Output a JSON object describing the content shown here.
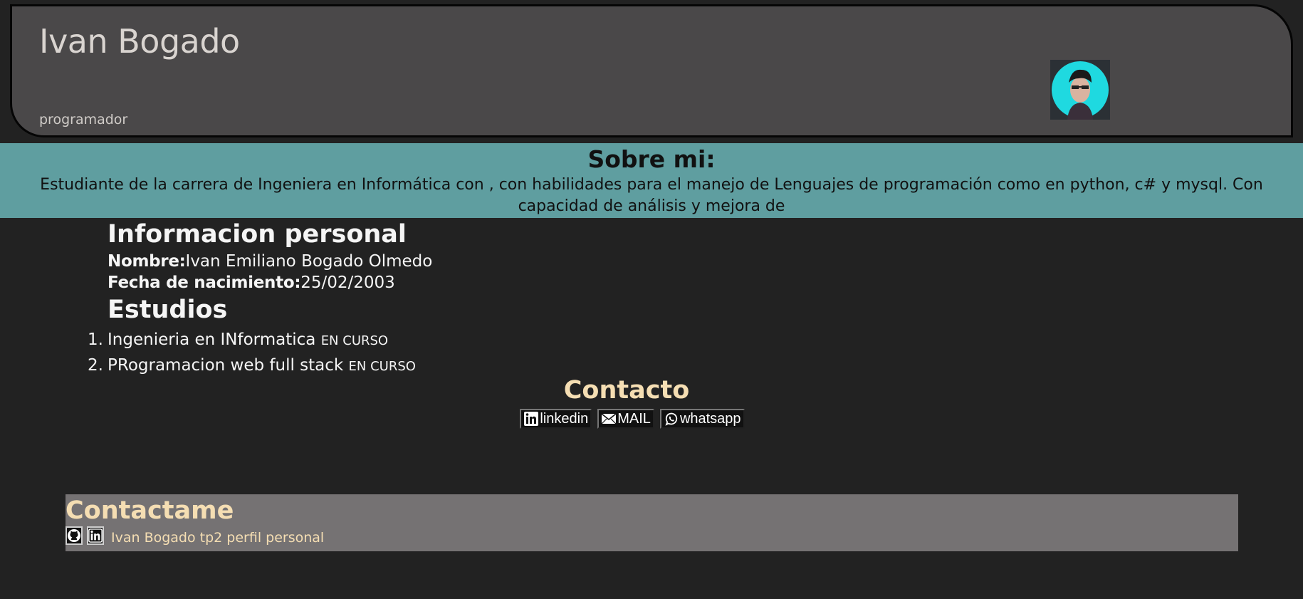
{
  "header": {
    "name": "Ivan Bogado",
    "role": "programador"
  },
  "about": {
    "title": "Sobre mi:",
    "text": "Estudiante de la carrera de Ingeniera en Informática con , con habilidades para el manejo de Lenguajes de programación como en python, c# y mysql. Con capacidad de análisis y mejora de"
  },
  "personal": {
    "heading": "Informacion personal",
    "name_label": "Nombre:",
    "name_value": "Ivan Emiliano Bogado Olmedo",
    "birth_label": "Fecha de nacimiento:",
    "birth_value": "25/02/2003"
  },
  "studies": {
    "heading": "Estudios",
    "items": [
      {
        "num": "1.",
        "title": "Ingenieria en INformatica",
        "status": "EN CURSO"
      },
      {
        "num": "2.",
        "title": "PRogramacion web full stack",
        "status": "EN CURSO"
      }
    ]
  },
  "contact": {
    "heading": "Contacto",
    "buttons": [
      {
        "label": "linkedin",
        "icon": "linkedin-icon"
      },
      {
        "label": "MAIL",
        "icon": "mail-icon"
      },
      {
        "label": "whatsapp",
        "icon": "whatsapp-icon"
      }
    ]
  },
  "footer": {
    "heading": "Contactame",
    "icons": [
      "github-icon",
      "linkedin-icon"
    ],
    "text": "Ivan Bogado tp2 perfil personal"
  },
  "colors": {
    "background": "#222222",
    "header_bg": "#4a4849",
    "about_bg": "#5f9ea0",
    "accent": "#f5deb3",
    "footer_bg": "#757273"
  }
}
